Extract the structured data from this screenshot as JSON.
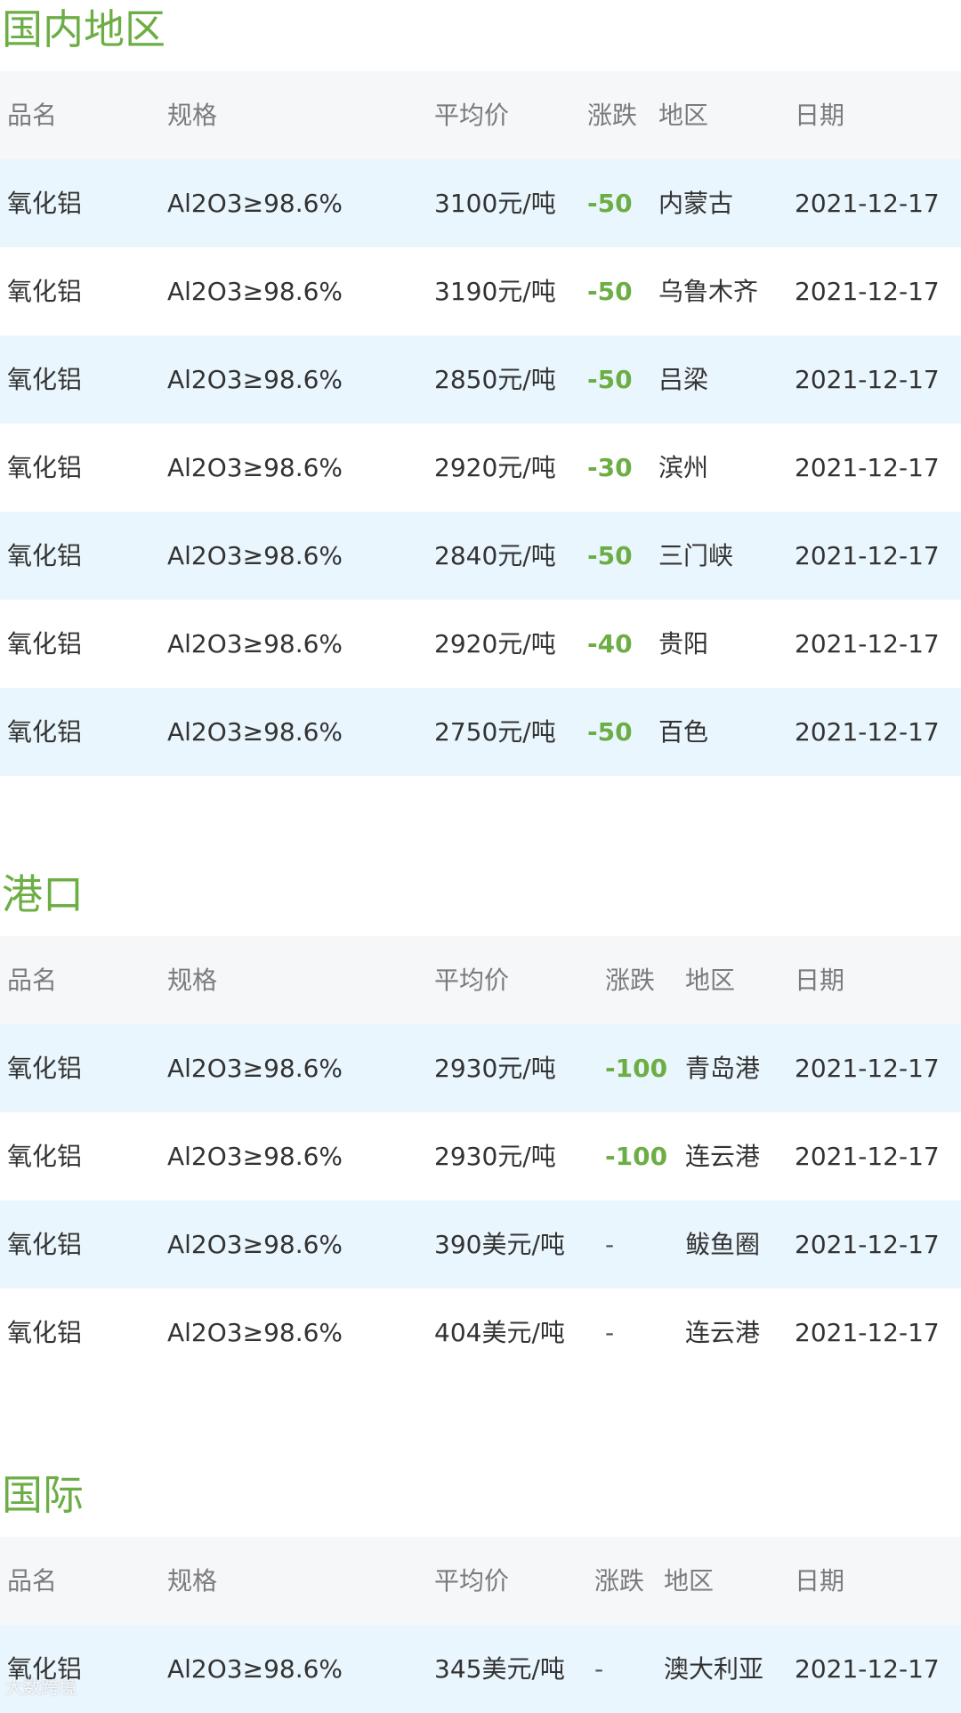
{
  "headers": {
    "name": "品名",
    "spec": "规格",
    "price": "平均价",
    "change": "涨跌",
    "region": "地区",
    "date": "日期"
  },
  "domestic": {
    "title": "国内地区",
    "rows": [
      {
        "name": "氧化铝",
        "spec": "Al2O3≥98.6%",
        "price": "3100元/吨",
        "change": "-50",
        "region": "内蒙古",
        "date": "2021-12-17"
      },
      {
        "name": "氧化铝",
        "spec": "Al2O3≥98.6%",
        "price": "3190元/吨",
        "change": "-50",
        "region": "乌鲁木齐",
        "date": "2021-12-17"
      },
      {
        "name": "氧化铝",
        "spec": "Al2O3≥98.6%",
        "price": "2850元/吨",
        "change": "-50",
        "region": "吕梁",
        "date": "2021-12-17"
      },
      {
        "name": "氧化铝",
        "spec": "Al2O3≥98.6%",
        "price": "2920元/吨",
        "change": "-30",
        "region": "滨州",
        "date": "2021-12-17"
      },
      {
        "name": "氧化铝",
        "spec": "Al2O3≥98.6%",
        "price": "2840元/吨",
        "change": "-50",
        "region": "三门峡",
        "date": "2021-12-17"
      },
      {
        "name": "氧化铝",
        "spec": "Al2O3≥98.6%",
        "price": "2920元/吨",
        "change": "-40",
        "region": "贵阳",
        "date": "2021-12-17"
      },
      {
        "name": "氧化铝",
        "spec": "Al2O3≥98.6%",
        "price": "2750元/吨",
        "change": "-50",
        "region": "百色",
        "date": "2021-12-17"
      }
    ]
  },
  "port": {
    "title": "港口",
    "rows": [
      {
        "name": "氧化铝",
        "spec": "Al2O3≥98.6%",
        "price": "2930元/吨",
        "change": "-100",
        "region": "青岛港",
        "date": "2021-12-17"
      },
      {
        "name": "氧化铝",
        "spec": "Al2O3≥98.6%",
        "price": "2930元/吨",
        "change": "-100",
        "region": "连云港",
        "date": "2021-12-17"
      },
      {
        "name": "氧化铝",
        "spec": "Al2O3≥98.6%",
        "price": "390美元/吨",
        "change": "-",
        "region": "鲅鱼圈",
        "date": "2021-12-17"
      },
      {
        "name": "氧化铝",
        "spec": "Al2O3≥98.6%",
        "price": "404美元/吨",
        "change": "-",
        "region": "连云港",
        "date": "2021-12-17"
      }
    ]
  },
  "international": {
    "title": "国际",
    "rows": [
      {
        "name": "氧化铝",
        "spec": "Al2O3≥98.6%",
        "price": "345美元/吨",
        "change": "-",
        "region": "澳大利亚",
        "date": "2021-12-17"
      }
    ]
  },
  "watermark": "大数跨境",
  "colors": {
    "accent": "#6cae45",
    "row_alt": "#eaf6fd",
    "header_bg": "#f6f7f9",
    "text": "#333333",
    "muted": "#7b7b7b"
  }
}
